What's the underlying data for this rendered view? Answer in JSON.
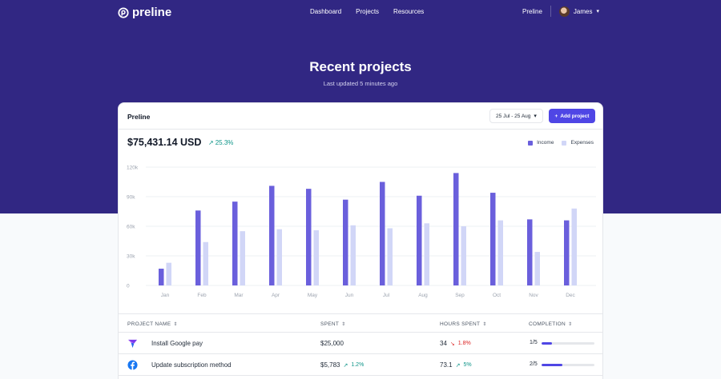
{
  "nav": {
    "brand": "preline",
    "links": [
      "Dashboard",
      "Projects",
      "Resources"
    ],
    "workspace": "Preline",
    "user": "James"
  },
  "hero": {
    "title": "Recent projects",
    "subtitle": "Last updated 5 minutes ago"
  },
  "card": {
    "title": "Preline",
    "date_range": "25 Jul - 25 Aug",
    "add_label": "Add project",
    "total": "$75,431.14 USD",
    "growth": "25.3%"
  },
  "colors": {
    "hero_bg": "#312783",
    "income": "#6a5fdc",
    "expenses": "#d1d6f7",
    "accent": "#4f46e5",
    "positive": "#0d9488",
    "negative": "#dc2626"
  },
  "chart_data": {
    "type": "bar",
    "categories": [
      "Jan",
      "Feb",
      "Mar",
      "Apr",
      "May",
      "Jun",
      "Jul",
      "Aug",
      "Sep",
      "Oct",
      "Nov",
      "Dec"
    ],
    "series": [
      {
        "name": "Income",
        "values": [
          17000,
          76000,
          85000,
          101000,
          98000,
          87000,
          105000,
          91000,
          114000,
          94000,
          67000,
          66000
        ]
      },
      {
        "name": "Expenses",
        "values": [
          23000,
          44000,
          55000,
          57000,
          56000,
          61000,
          58000,
          63000,
          60000,
          66000,
          34000,
          78000
        ]
      }
    ],
    "y_ticks": [
      "0",
      "30k",
      "60k",
      "90k",
      "120k"
    ],
    "ylim": [
      0,
      120000
    ],
    "grid": true,
    "legend": "top-right"
  },
  "table": {
    "headers": [
      "PROJECT NAME",
      "SPENT",
      "HOURS SPENT",
      "COMPLETION"
    ],
    "rows": [
      {
        "icon": "google-pay-icon",
        "name": "Install Google pay",
        "spent": "$25,000",
        "hours": "34",
        "trend": "1.8%",
        "trend_dir": "down",
        "completion": "1/5",
        "progress": 0.2
      },
      {
        "icon": "facebook-icon",
        "name": "Update subscription method",
        "spent": "$5,783",
        "spent_trend": "1.2%",
        "hours": "73.1",
        "trend": "5%",
        "trend_dir": "up",
        "completion": "2/5",
        "progress": 0.4
      }
    ]
  }
}
